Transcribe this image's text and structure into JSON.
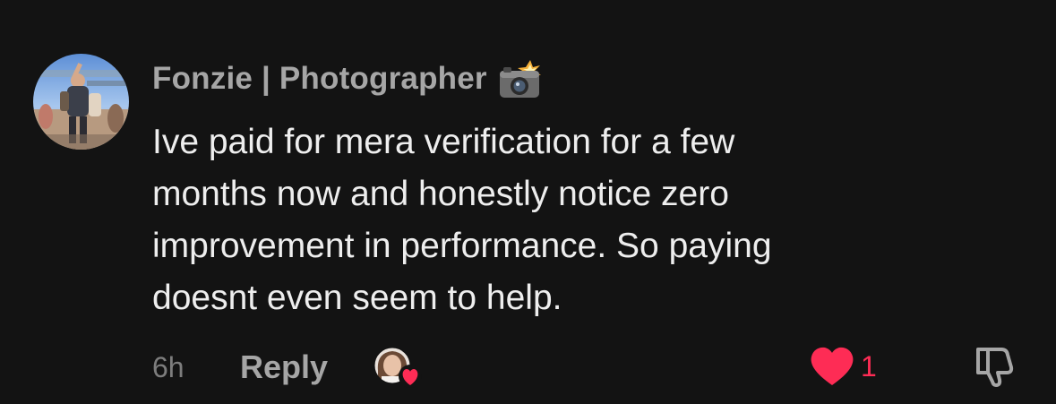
{
  "comment": {
    "username": "Fonzie | Photographer",
    "username_badge_icon": "camera-with-flash-icon",
    "text_lines": [
      "Ive paid for mera verification for a few",
      "months now and honestly notice zero",
      "improvement in performance. So paying",
      "doesnt even seem to help."
    ],
    "timestamp": "6h",
    "reply_label": "Reply",
    "like_count": "1",
    "liked": true
  },
  "colors": {
    "background": "#131313",
    "username": "#a6a6a6",
    "text": "#eeeeee",
    "muted": "#7d7d7d",
    "like": "#fe2c55"
  }
}
